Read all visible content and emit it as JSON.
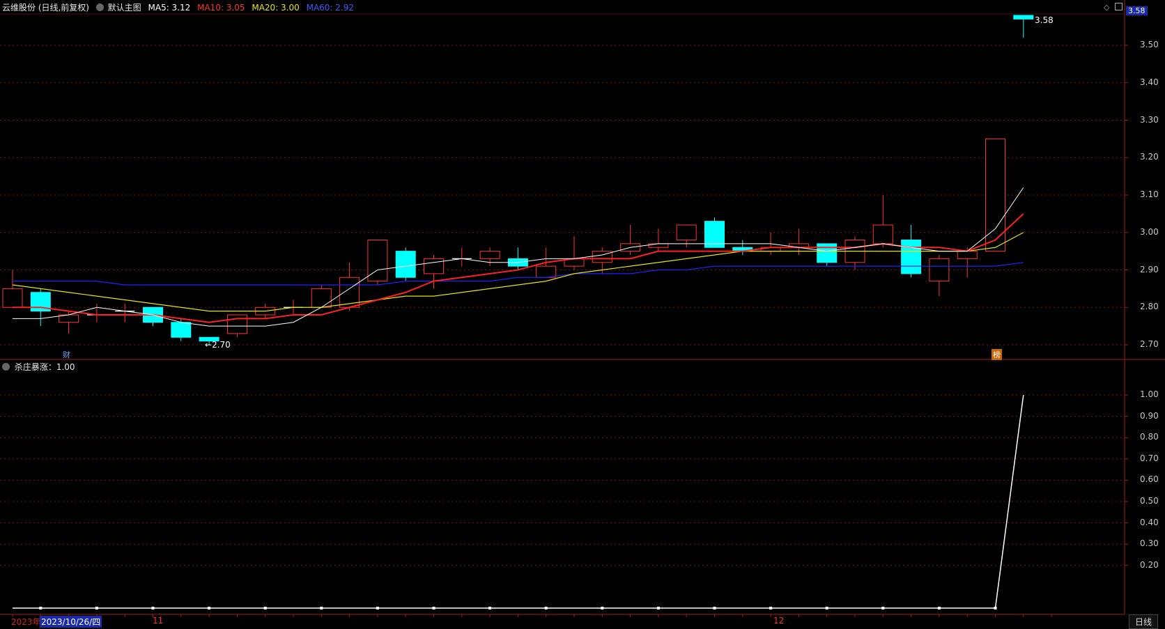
{
  "header": {
    "title": "云维股份 (日线,前复权)",
    "main_chart_label": "默认主图",
    "ma5": "MA5: 3.12",
    "ma10": "MA10: 3.05",
    "ma20": "MA20: 3.00",
    "ma60": "MA60: 2.92"
  },
  "price_axis": {
    "current_price": "3.58",
    "ticks": [
      "3.50",
      "3.40",
      "3.30",
      "3.20",
      "3.10",
      "3.00",
      "2.90",
      "2.80",
      "2.70"
    ]
  },
  "annotations": {
    "low_label": "2.70",
    "high_label": "3.58",
    "marker_cai": "财",
    "marker_bang": "榜"
  },
  "indicator": {
    "label": "杀庄暴涨：1.00",
    "ticks": [
      "1.00",
      "0.90",
      "0.80",
      "0.70",
      "0.60",
      "0.50",
      "0.40",
      "0.30",
      "0.20"
    ]
  },
  "date_axis": {
    "year_label": "2023年",
    "selected_date": "2023/10/26/四",
    "month_11": "11",
    "month_12": "12",
    "period_button": "日线"
  },
  "colors": {
    "up": "#ff3333",
    "down": "#00ffff",
    "ma5": "#ffffff",
    "ma10": "#ff2020",
    "ma20": "#e6e600",
    "ma60": "#2020ff",
    "grid": "#7a1010"
  },
  "chart_data": {
    "type": "candlestick",
    "ylim": [
      2.67,
      3.6
    ],
    "candles": [
      {
        "o": 2.8,
        "c": 2.85,
        "h": 2.9,
        "l": 2.8
      },
      {
        "o": 2.84,
        "c": 2.79,
        "h": 2.85,
        "l": 2.75
      },
      {
        "o": 2.76,
        "c": 2.78,
        "h": 2.79,
        "l": 2.73
      },
      {
        "o": 2.78,
        "c": 2.78,
        "h": 2.81,
        "l": 2.76
      },
      {
        "o": 2.79,
        "c": 2.79,
        "h": 2.81,
        "l": 2.76
      },
      {
        "o": 2.8,
        "c": 2.76,
        "h": 2.8,
        "l": 2.75
      },
      {
        "o": 2.76,
        "c": 2.72,
        "h": 2.77,
        "l": 2.71
      },
      {
        "o": 2.72,
        "c": 2.71,
        "h": 2.72,
        "l": 2.7
      },
      {
        "o": 2.73,
        "c": 2.78,
        "h": 2.78,
        "l": 2.72
      },
      {
        "o": 2.78,
        "c": 2.8,
        "h": 2.81,
        "l": 2.77
      },
      {
        "o": 2.8,
        "c": 2.8,
        "h": 2.82,
        "l": 2.78
      },
      {
        "o": 2.8,
        "c": 2.85,
        "h": 2.86,
        "l": 2.8
      },
      {
        "o": 2.8,
        "c": 2.88,
        "h": 2.92,
        "l": 2.79
      },
      {
        "o": 2.87,
        "c": 2.98,
        "h": 2.98,
        "l": 2.86
      },
      {
        "o": 2.95,
        "c": 2.88,
        "h": 2.96,
        "l": 2.87
      },
      {
        "o": 2.89,
        "c": 2.93,
        "h": 2.94,
        "l": 2.85
      },
      {
        "o": 2.93,
        "c": 2.93,
        "h": 2.96,
        "l": 2.91
      },
      {
        "o": 2.93,
        "c": 2.95,
        "h": 2.96,
        "l": 2.91
      },
      {
        "o": 2.93,
        "c": 2.91,
        "h": 2.96,
        "l": 2.9
      },
      {
        "o": 2.88,
        "c": 2.91,
        "h": 2.96,
        "l": 2.88
      },
      {
        "o": 2.91,
        "c": 2.93,
        "h": 2.99,
        "l": 2.9
      },
      {
        "o": 2.92,
        "c": 2.95,
        "h": 2.96,
        "l": 2.89
      },
      {
        "o": 2.95,
        "c": 2.97,
        "h": 3.02,
        "l": 2.94
      },
      {
        "o": 2.96,
        "c": 2.97,
        "h": 3.01,
        "l": 2.95
      },
      {
        "o": 2.98,
        "c": 3.02,
        "h": 3.02,
        "l": 2.96
      },
      {
        "o": 3.03,
        "c": 2.96,
        "h": 3.04,
        "l": 2.96
      },
      {
        "o": 2.96,
        "c": 2.95,
        "h": 2.98,
        "l": 2.94
      },
      {
        "o": 2.95,
        "c": 2.96,
        "h": 3.0,
        "l": 2.94
      },
      {
        "o": 2.96,
        "c": 2.97,
        "h": 3.01,
        "l": 2.94
      },
      {
        "o": 2.97,
        "c": 2.92,
        "h": 2.97,
        "l": 2.91
      },
      {
        "o": 2.92,
        "c": 2.98,
        "h": 2.99,
        "l": 2.9
      },
      {
        "o": 2.97,
        "c": 3.02,
        "h": 3.1,
        "l": 2.96
      },
      {
        "o": 2.98,
        "c": 2.89,
        "h": 3.02,
        "l": 2.88
      },
      {
        "o": 2.87,
        "c": 2.93,
        "h": 2.94,
        "l": 2.83
      },
      {
        "o": 2.93,
        "c": 2.95,
        "h": 2.96,
        "l": 2.88
      },
      {
        "o": 2.95,
        "c": 3.25,
        "h": 3.25,
        "l": 2.95
      },
      {
        "o": 3.58,
        "c": 3.57,
        "h": 3.58,
        "l": 3.52
      }
    ],
    "ma5": [
      2.77,
      2.77,
      2.78,
      2.8,
      2.79,
      2.78,
      2.76,
      2.75,
      2.75,
      2.75,
      2.76,
      2.8,
      2.85,
      2.9,
      2.91,
      2.92,
      2.93,
      2.92,
      2.92,
      2.93,
      2.93,
      2.94,
      2.96,
      2.97,
      2.97,
      2.97,
      2.97,
      2.97,
      2.96,
      2.95,
      2.96,
      2.97,
      2.96,
      2.95,
      2.95,
      3.01,
      3.12
    ],
    "ma10": [
      2.8,
      2.8,
      2.79,
      2.78,
      2.78,
      2.78,
      2.77,
      2.76,
      2.77,
      2.77,
      2.78,
      2.78,
      2.8,
      2.82,
      2.84,
      2.87,
      2.88,
      2.89,
      2.9,
      2.92,
      2.93,
      2.93,
      2.93,
      2.95,
      2.95,
      2.95,
      2.95,
      2.96,
      2.96,
      2.96,
      2.96,
      2.97,
      2.96,
      2.96,
      2.95,
      2.98,
      3.05
    ],
    "ma20": [
      2.86,
      2.85,
      2.84,
      2.83,
      2.82,
      2.81,
      2.8,
      2.79,
      2.79,
      2.79,
      2.8,
      2.8,
      2.81,
      2.82,
      2.83,
      2.83,
      2.84,
      2.85,
      2.86,
      2.87,
      2.89,
      2.9,
      2.91,
      2.92,
      2.93,
      2.94,
      2.95,
      2.95,
      2.95,
      2.95,
      2.95,
      2.95,
      2.95,
      2.95,
      2.95,
      2.96,
      3.0
    ],
    "ma60": [
      2.87,
      2.87,
      2.87,
      2.87,
      2.86,
      2.86,
      2.86,
      2.86,
      2.86,
      2.86,
      2.86,
      2.86,
      2.86,
      2.86,
      2.87,
      2.87,
      2.87,
      2.87,
      2.88,
      2.88,
      2.89,
      2.89,
      2.89,
      2.9,
      2.9,
      2.91,
      2.91,
      2.91,
      2.91,
      2.91,
      2.91,
      2.91,
      2.91,
      2.91,
      2.91,
      2.91,
      2.92
    ],
    "indicator_values": [
      0,
      0,
      0,
      0,
      0,
      0,
      0,
      0,
      0,
      0,
      0,
      0,
      0,
      0,
      0,
      0,
      0,
      0,
      0,
      0,
      0,
      0,
      0,
      0,
      0,
      0,
      0,
      0,
      0,
      0,
      0,
      0,
      0,
      0,
      0,
      0,
      1.0
    ],
    "indicator_ylim": [
      0,
      1.05
    ]
  }
}
